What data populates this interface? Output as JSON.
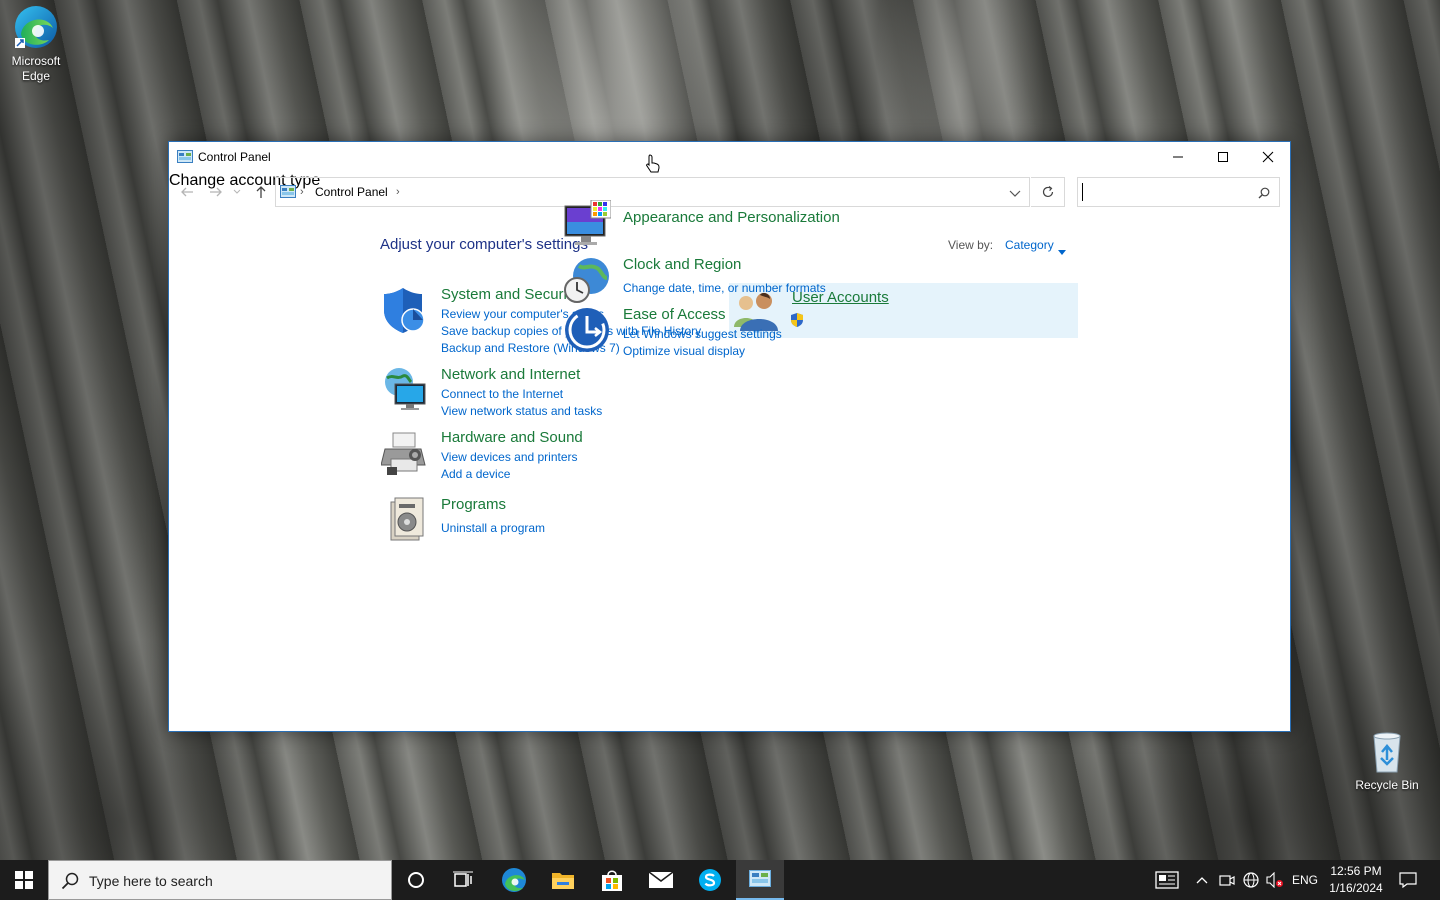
{
  "desktop": {
    "edge_label": "Microsoft Edge",
    "recycle_label": "Recycle Bin"
  },
  "window": {
    "title": "Control Panel",
    "breadcrumb": "Control Panel",
    "search_value": "",
    "heading": "Adjust your computer's settings",
    "view_by_label": "View by:",
    "view_by_value": "Category"
  },
  "categories": {
    "system": {
      "title": "System and Security",
      "links": [
        "Review your computer's status",
        "Save backup copies of your files with File History",
        "Backup and Restore (Windows 7)"
      ]
    },
    "network": {
      "title": "Network and Internet",
      "links": [
        "Connect to the Internet",
        "View network status and tasks"
      ]
    },
    "hardware": {
      "title": "Hardware and Sound",
      "links": [
        "View devices and printers",
        "Add a device"
      ]
    },
    "programs": {
      "title": "Programs",
      "links": [
        "Uninstall a program"
      ]
    },
    "users": {
      "title": "User Accounts",
      "links": [
        "Change account type"
      ]
    },
    "appearance": {
      "title": "Appearance and Personalization",
      "links": []
    },
    "clock": {
      "title": "Clock and Region",
      "links": [
        "Change date, time, or number formats"
      ]
    },
    "ease": {
      "title": "Ease of Access",
      "links": [
        "Let Windows suggest settings",
        "Optimize visual display"
      ]
    }
  },
  "taskbar": {
    "search_placeholder": "Type here to search",
    "language": "ENG",
    "time": "12:56 PM",
    "date": "1/16/2024"
  },
  "colors": {
    "category_title": "#1a7a3a",
    "link": "#0066cc",
    "heading": "#1e3287",
    "hover_bg": "#e5f3fb",
    "taskbar": "#1c1c1c"
  }
}
